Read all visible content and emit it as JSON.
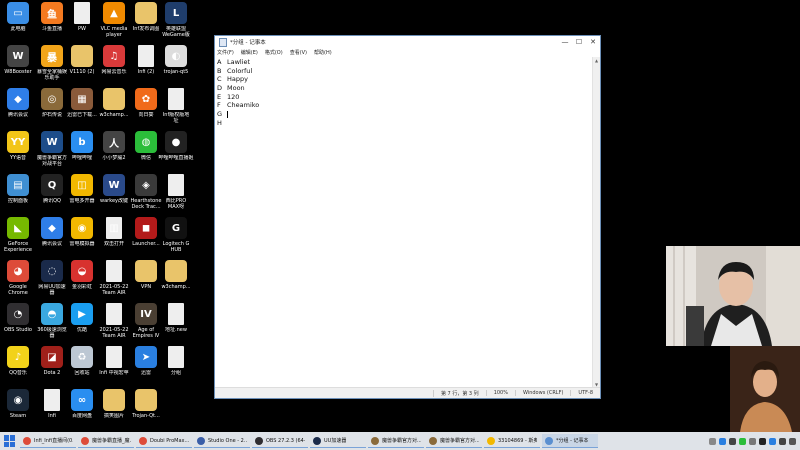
{
  "desktop_icons": [
    {
      "label": "此电脑",
      "color": "#3a8ee6",
      "glyph": "▭"
    },
    {
      "label": "斗鱼直播",
      "color": "#f47a20",
      "glyph": "鱼"
    },
    {
      "label": "PW",
      "color": "#eeeeee",
      "glyph": ""
    },
    {
      "label": "VLC media\nplayer",
      "color": "#f08a00",
      "glyph": "▲"
    },
    {
      "label": "Inf发布调图",
      "color": "#e9c46a",
      "glyph": ""
    },
    {
      "label": "英雄联盟\nWeGame版",
      "color": "#1f3d6b",
      "glyph": "L"
    },
    {
      "label": "W8Booster",
      "color": "#444444",
      "glyph": "W"
    },
    {
      "label": "暴雪全家桶娱\n乐助手",
      "color": "#f2a51a",
      "glyph": "暴"
    },
    {
      "label": "V1110 (2)",
      "color": "#e9c46a",
      "glyph": ""
    },
    {
      "label": "网易云音乐",
      "color": "#d93a3a",
      "glyph": "♫"
    },
    {
      "label": "Infi (2)",
      "color": "#eeeeee",
      "glyph": ""
    },
    {
      "label": "trojan-qt5",
      "color": "#dddddd",
      "glyph": "◐"
    },
    {
      "label": "腾讯会议",
      "color": "#2f7ee8",
      "glyph": "◆"
    },
    {
      "label": "炉石传说",
      "color": "#8a6a3a",
      "glyph": "◎"
    },
    {
      "label": "迅雷已下载...",
      "color": "#8a5a3a",
      "glyph": "▦"
    },
    {
      "label": "w3champ...",
      "color": "#e9c46a",
      "glyph": ""
    },
    {
      "label": "向日葵",
      "color": "#f06a1a",
      "glyph": "✿"
    },
    {
      "label": "Inf版权版地\n址",
      "color": "#eeeeee",
      "glyph": ""
    },
    {
      "label": "YY语音",
      "color": "#f2c518",
      "glyph": "YY"
    },
    {
      "label": "魔兽争霸官方\n对战平台",
      "color": "#1d4d8a",
      "glyph": "W"
    },
    {
      "label": "哔哩哔哩",
      "color": "#2a8ef0",
      "glyph": "b"
    },
    {
      "label": "小小梦魇2",
      "color": "#444444",
      "glyph": "人"
    },
    {
      "label": "微信",
      "color": "#2bbd3a",
      "glyph": "◍"
    },
    {
      "label": "哔哩哔哩直播姬",
      "color": "#222222",
      "glyph": "●"
    },
    {
      "label": "控制面板",
      "color": "#3f8fd2",
      "glyph": "▤"
    },
    {
      "label": "腾讯QQ",
      "color": "#222222",
      "glyph": "Q"
    },
    {
      "label": "雷电多开器",
      "color": "#f2b800",
      "glyph": "◫"
    },
    {
      "label": "warkey改键",
      "color": "#2a4a8a",
      "glyph": "W"
    },
    {
      "label": "Hearthstone\nDeck Trac...",
      "color": "#3a3a3a",
      "glyph": "◈"
    },
    {
      "label": "西比PRO\nMAX呀",
      "color": "#eeeeee",
      "glyph": ""
    },
    {
      "label": "GeForce\nExperience",
      "color": "#76b900",
      "glyph": "◣"
    },
    {
      "label": "腾讯会议",
      "color": "#2f7ee8",
      "glyph": "◆"
    },
    {
      "label": "雷电模拟器",
      "color": "#f2b800",
      "glyph": "◉"
    },
    {
      "label": "双击打开",
      "color": "#eeeeee",
      "glyph": "▥"
    },
    {
      "label": "Launcher...",
      "color": "#b31a1a",
      "glyph": "◼"
    },
    {
      "label": "Logitech G\nHUB",
      "color": "#111111",
      "glyph": "G"
    },
    {
      "label": "Google\nChrome",
      "color": "#dd4b39",
      "glyph": "◕"
    },
    {
      "label": "网易UU加速\n器",
      "color": "#1a2a4a",
      "glyph": "◌"
    },
    {
      "label": "金羽彩虹",
      "color": "#d8322f",
      "glyph": "◒"
    },
    {
      "label": "2021-05-22\nTeam AIR",
      "color": "#eeeeee",
      "glyph": ""
    },
    {
      "label": "VPN",
      "color": "#e9c46a",
      "glyph": ""
    },
    {
      "label": "w3champ...",
      "color": "#e9c46a",
      "glyph": ""
    },
    {
      "label": "OBS Studio",
      "color": "#302e31",
      "glyph": "◔"
    },
    {
      "label": "360极速浏览\n器",
      "color": "#3aa8e0",
      "glyph": "◓"
    },
    {
      "label": "优酷",
      "color": "#1a9ef0",
      "glyph": "▶"
    },
    {
      "label": "2021-05-22\nTeam AIR",
      "color": "#eeeeee",
      "glyph": ""
    },
    {
      "label": "Age of\nEmpires IV",
      "color": "#4a3f33",
      "glyph": "IV"
    },
    {
      "label": "地址.new",
      "color": "#eeeeee",
      "glyph": ""
    },
    {
      "label": "QQ音乐",
      "color": "#f2d21a",
      "glyph": "♪"
    },
    {
      "label": "Dota 2",
      "color": "#a0201a",
      "glyph": "◪"
    },
    {
      "label": "回收站",
      "color": "#bcc7d3",
      "glyph": "♻"
    },
    {
      "label": "Infi 中视宏苹",
      "color": "#eeeeee",
      "glyph": ""
    },
    {
      "label": "迅雷",
      "color": "#2a7fe0",
      "glyph": "➤"
    },
    {
      "label": "分组",
      "color": "#eeeeee",
      "glyph": ""
    },
    {
      "label": "Steam",
      "color": "#1b2838",
      "glyph": "◉"
    },
    {
      "label": "Infi",
      "color": "#eeeeee",
      "glyph": ""
    },
    {
      "label": "百度网盘",
      "color": "#2a8ef0",
      "glyph": "∞"
    },
    {
      "label": "搞笑图片",
      "color": "#e9c46a",
      "glyph": ""
    },
    {
      "label": "Trojan-Qt...",
      "color": "#e9c46a",
      "glyph": ""
    }
  ],
  "notepad": {
    "title": "*分组 - 记事本",
    "menu": [
      "文件(F)",
      "编辑(E)",
      "格式(O)",
      "查看(V)",
      "帮助(H)"
    ],
    "lines": [
      {
        "key": "A",
        "text": "Lawliet"
      },
      {
        "key": "B",
        "text": "Colorful"
      },
      {
        "key": "C",
        "text": "Happy"
      },
      {
        "key": "D",
        "text": "Moon"
      },
      {
        "key": "E",
        "text": "120"
      },
      {
        "key": "F",
        "text": "Cheamiko"
      },
      {
        "key": "G",
        "text": ""
      },
      {
        "key": "H",
        "text": ""
      }
    ],
    "status": {
      "position": "第 7 行，第 3 列",
      "zoom": "100%",
      "eol": "Windows (CRLF)",
      "encoding": "UTF-8"
    },
    "window_buttons": {
      "minimize": "—",
      "maximize": "☐",
      "close": "✕"
    }
  },
  "taskbar": {
    "items": [
      {
        "label": "Infi_Infi直播间(0...",
        "color": "#dd4b39"
      },
      {
        "label": "魔兽争霸直播_魔...",
        "color": "#dd4b39"
      },
      {
        "label": "Doubi ProMax...",
        "color": "#dd4b39"
      },
      {
        "label": "Studio One - 2...",
        "color": "#3a5ea8"
      },
      {
        "label": "OBS 27.2.3 (64-...",
        "color": "#302e31"
      },
      {
        "label": "UU加速器",
        "color": "#1a2a4a"
      },
      {
        "label": "魔兽争霸官方对...",
        "color": "#8a6a3a"
      },
      {
        "label": "魔兽争霸官方对...",
        "color": "#8a6a3a"
      },
      {
        "label": "33104869 - 斯奥...",
        "color": "#f2b800"
      },
      {
        "label": "*分组 - 记事本",
        "color": "#5a8fd0"
      }
    ],
    "tray_colors": [
      "#888888",
      "#2a7fe0",
      "#444444",
      "#2bbd3a",
      "#777777",
      "#222222",
      "#2a7fe0",
      "#444444",
      "#555555"
    ]
  }
}
